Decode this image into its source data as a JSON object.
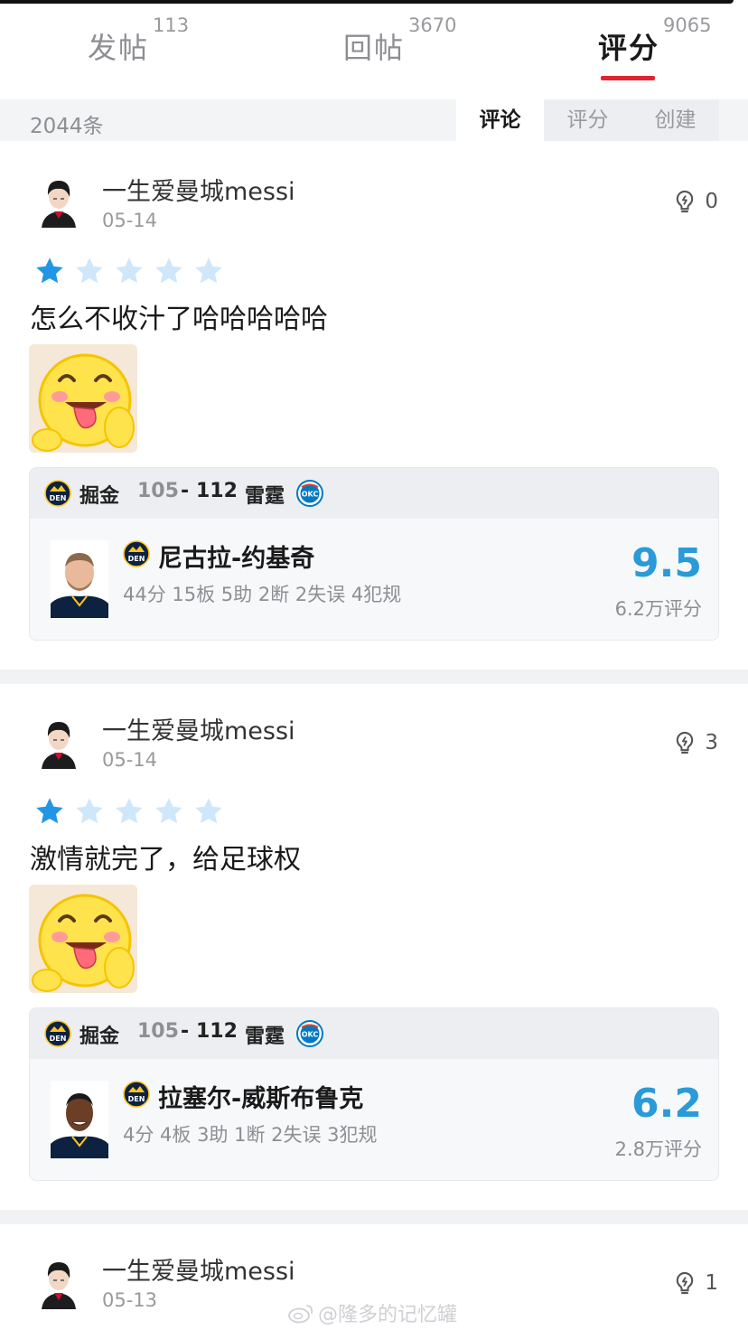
{
  "tabs": [
    {
      "label": "发帖",
      "count": "113",
      "active": false
    },
    {
      "label": "回帖",
      "count": "3670",
      "active": false
    },
    {
      "label": "评分",
      "count": "9065",
      "active": true
    }
  ],
  "subbar": {
    "total": "2044条",
    "segments": [
      {
        "label": "评论",
        "active": true
      },
      {
        "label": "评分",
        "active": false
      },
      {
        "label": "创建",
        "active": false
      }
    ]
  },
  "colors": {
    "accent_red": "#e0242f",
    "rating_blue": "#2a9ad8",
    "star_filled": "#2196e6",
    "star_empty": "#cfe7fb"
  },
  "posts": [
    {
      "username": "一生爱曼城messi",
      "date": "05-14",
      "likes": "0",
      "stars_filled": 1,
      "stars_total": 5,
      "text": "怎么不收汁了哈哈哈哈哈",
      "sticker": "laughing-tongue-emoji",
      "match": {
        "home_team": "掘金",
        "home_score": "105",
        "dash": "-",
        "away_score": "112",
        "away_team": "雷霆",
        "home_logo": "DEN",
        "away_logo": "OKC",
        "player": {
          "name": "尼古拉-约基奇",
          "stats": "44分 15板 5助 2断 2失误 4犯规",
          "rating": "9.5",
          "rating_count": "6.2万评分"
        }
      }
    },
    {
      "username": "一生爱曼城messi",
      "date": "05-14",
      "likes": "3",
      "stars_filled": 1,
      "stars_total": 5,
      "text": "激情就完了，给足球权",
      "sticker": "laughing-tongue-emoji",
      "match": {
        "home_team": "掘金",
        "home_score": "105",
        "dash": "-",
        "away_score": "112",
        "away_team": "雷霆",
        "home_logo": "DEN",
        "away_logo": "OKC",
        "player": {
          "name": "拉塞尔-威斯布鲁克",
          "stats": "4分 4板 3助 1断 2失误 3犯规",
          "rating": "6.2",
          "rating_count": "2.8万评分"
        }
      }
    },
    {
      "username": "一生爱曼城messi",
      "date": "05-13",
      "likes": "1"
    }
  ],
  "watermark": "@隆多的记忆罐"
}
